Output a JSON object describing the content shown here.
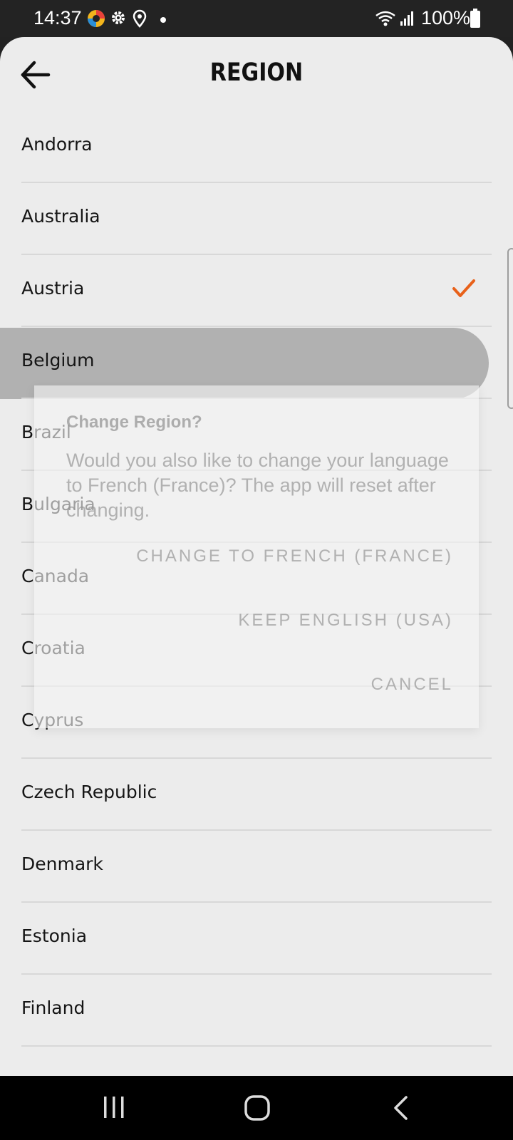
{
  "status_bar": {
    "time": "14:37",
    "battery_percent": "100%",
    "icons": [
      "app-notification-icon",
      "settings-icon",
      "location-icon",
      "dot-icon",
      "wifi-icon",
      "signal-icon",
      "battery-icon"
    ]
  },
  "header": {
    "title": "REGION",
    "back_icon": "arrow-left-icon"
  },
  "regions": [
    {
      "label": "Andorra",
      "selected": false
    },
    {
      "label": "Australia",
      "selected": false
    },
    {
      "label": "Austria",
      "selected": true
    },
    {
      "label": "Belgium",
      "selected": false,
      "pressed": true
    },
    {
      "label": "Brazil",
      "selected": false
    },
    {
      "label": "Bulgaria",
      "selected": false
    },
    {
      "label": "Canada",
      "selected": false
    },
    {
      "label": "Croatia",
      "selected": false
    },
    {
      "label": "Cyprus",
      "selected": false
    },
    {
      "label": "Czech Republic",
      "selected": false
    },
    {
      "label": "Denmark",
      "selected": false
    },
    {
      "label": "Estonia",
      "selected": false
    },
    {
      "label": "Finland",
      "selected": false
    }
  ],
  "dialog": {
    "title": "Change Region?",
    "message": "Would you also like to change your language to French (France)? The app will reset after changing.",
    "buttons": {
      "change": "CHANGE TO FRENCH (FRANCE)",
      "keep": "KEEP ENGLISH (USA)",
      "cancel": "CANCEL"
    }
  },
  "colors": {
    "accent_check": "#e8611a",
    "sheet_bg": "#ececec",
    "pressed_bg": "#b1b1b1"
  }
}
